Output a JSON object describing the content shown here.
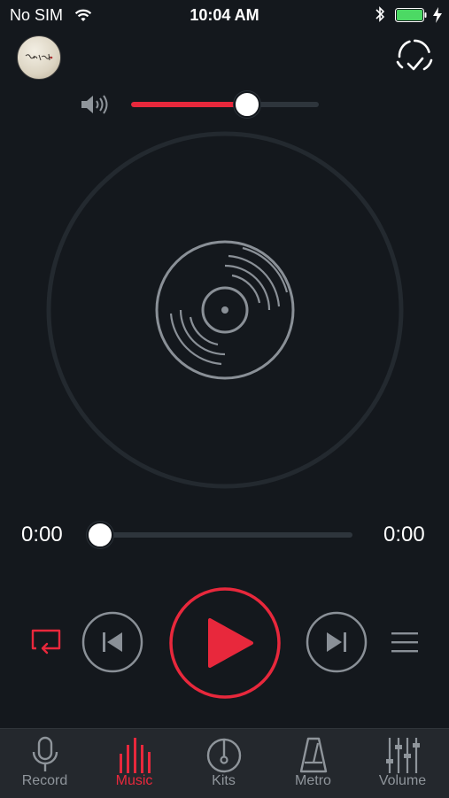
{
  "status_bar": {
    "carrier": "No SIM",
    "time": "10:04 AM",
    "battery_level": 1.0
  },
  "player": {
    "volume_level": 0.62,
    "progress_level": 0.0,
    "elapsed": "0:00",
    "total": "0:00"
  },
  "tabs": [
    {
      "label": "Record",
      "icon": "microphone-icon",
      "active": false
    },
    {
      "label": "Music",
      "icon": "equalizer-bars-icon",
      "active": true
    },
    {
      "label": "Kits",
      "icon": "drum-icon",
      "active": false
    },
    {
      "label": "Metro",
      "icon": "metronome-icon",
      "active": false
    },
    {
      "label": "Volume",
      "icon": "mixer-sliders-icon",
      "active": false
    }
  ],
  "colors": {
    "accent": "#e8283c",
    "background": "#14181d",
    "tab_bar": "#24282d",
    "icon_gray": "#8f959b"
  }
}
